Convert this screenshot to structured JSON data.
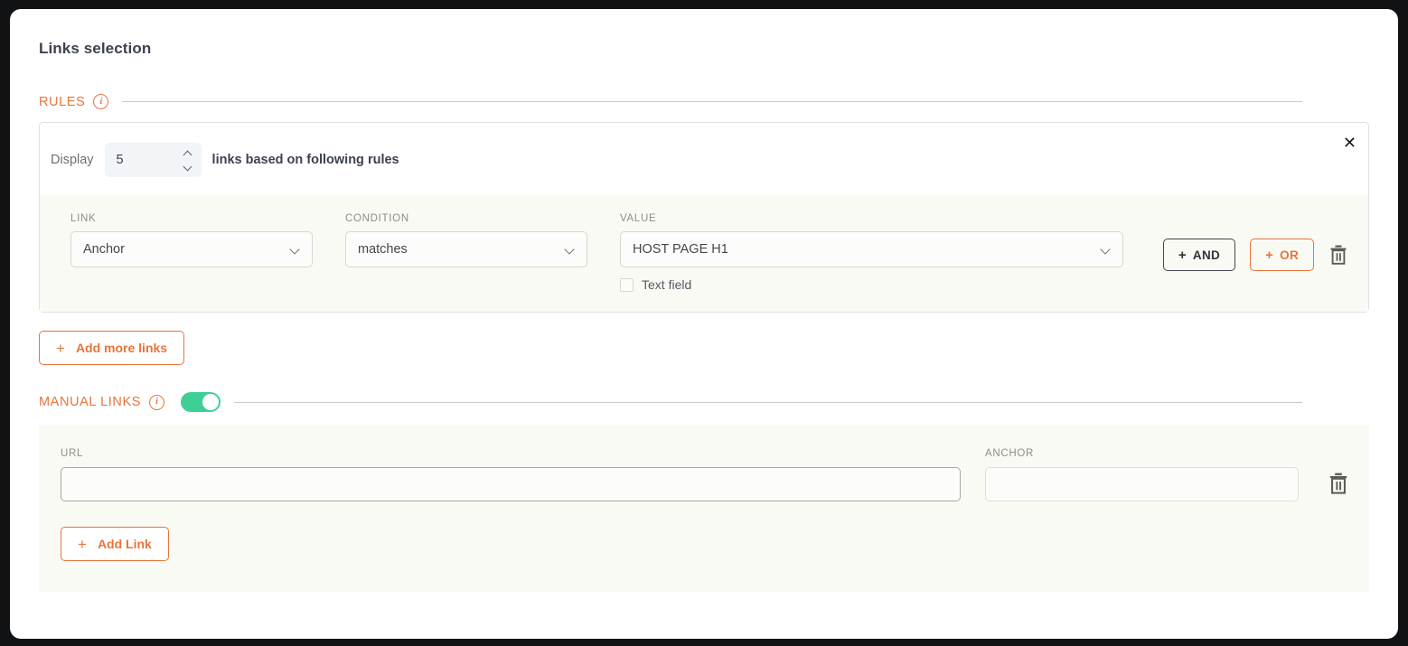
{
  "page": {
    "title": "Links selection"
  },
  "rules_section": {
    "label": "RULES",
    "info_icon": "info-icon",
    "close_icon": "close-icon",
    "display": {
      "prefix_label": "Display",
      "value": "5",
      "suffix_label": "links based on following rules",
      "stepper_up_icon": "chevron-up-icon",
      "stepper_down_icon": "chevron-down-icon"
    },
    "rule": {
      "link": {
        "label": "LINK",
        "value": "Anchor",
        "caret_icon": "chevron-down-icon"
      },
      "condition": {
        "label": "CONDITION",
        "value": "matches",
        "caret_icon": "chevron-down-icon"
      },
      "value": {
        "label": "VALUE",
        "value": "HOST PAGE H1",
        "caret_icon": "chevron-down-icon"
      },
      "text_field_checkbox": {
        "label": "Text field",
        "checked": false
      },
      "and_button": {
        "plus": "+",
        "label": "AND"
      },
      "or_button": {
        "plus": "+",
        "label": "OR"
      },
      "delete_icon": "trash-icon"
    },
    "add_more_links_button": {
      "plus": "+",
      "label": "Add more links"
    }
  },
  "manual_links_section": {
    "label": "MANUAL LINKS",
    "info_icon": "info-icon",
    "toggle": {
      "state": "on",
      "name": "manual-links-toggle"
    },
    "url_field": {
      "label": "URL",
      "value": "",
      "placeholder": ""
    },
    "anchor_field": {
      "label": "ANCHOR",
      "value": "",
      "placeholder": ""
    },
    "delete_icon": "trash-icon",
    "add_link_button": {
      "plus": "+",
      "label": "Add Link"
    }
  },
  "colors": {
    "accent_orange": "#e8743b",
    "toggle_green": "#3ecf96",
    "panel_cream": "#fafaf5",
    "text_dark": "#3d4250",
    "label_gray": "#8b8d8f"
  }
}
